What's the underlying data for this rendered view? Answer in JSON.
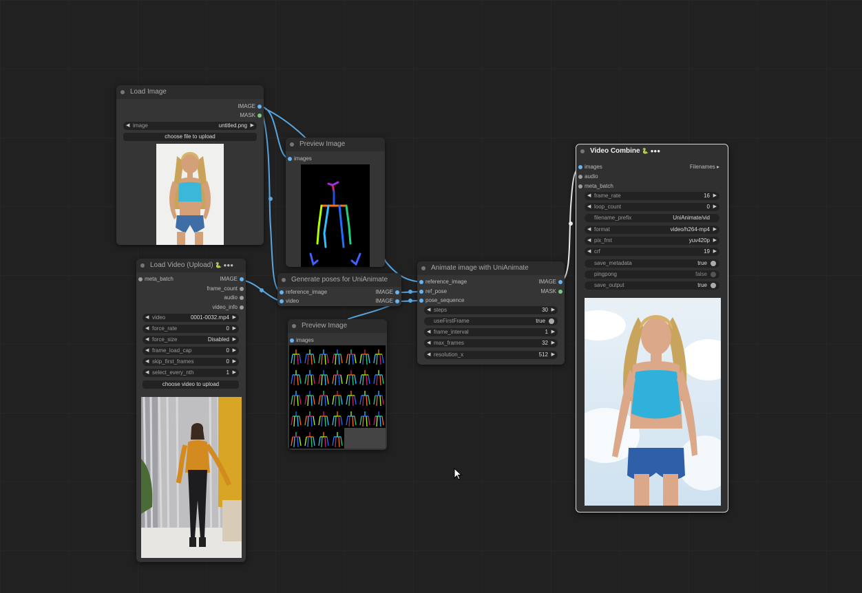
{
  "nodes": {
    "load_image": {
      "title": "Load Image",
      "outputs": [
        "IMAGE",
        "MASK"
      ],
      "widgets": {
        "image_label": "image",
        "image_value": "untitled.png"
      },
      "upload_button": "choose file to upload"
    },
    "preview_image_1": {
      "title": "Preview Image",
      "inputs": [
        "images"
      ]
    },
    "load_video": {
      "title": "Load Video (Upload)",
      "title_badges": "🐍 ●●●",
      "inputs": [
        "meta_batch"
      ],
      "outputs": [
        "IMAGE",
        "frame_count",
        "audio",
        "video_info"
      ],
      "widgets": [
        {
          "label": "video",
          "value": "0001-0032.mp4"
        },
        {
          "label": "force_rate",
          "value": "0"
        },
        {
          "label": "force_size",
          "value": "Disabled"
        },
        {
          "label": "frame_load_cap",
          "value": "0"
        },
        {
          "label": "skip_first_frames",
          "value": "0"
        },
        {
          "label": "select_every_nth",
          "value": "1"
        }
      ],
      "upload_button": "choose video to upload"
    },
    "generate_poses": {
      "title": "Generate poses for UniAnimate",
      "inputs": [
        "reference_image",
        "video"
      ],
      "outputs": [
        "IMAGE",
        "IMAGE"
      ]
    },
    "preview_image_2": {
      "title": "Preview Image",
      "inputs": [
        "images"
      ]
    },
    "animate": {
      "title": "Animate image with UniAnimate",
      "inputs": [
        "reference_image",
        "ref_pose",
        "pose_sequence"
      ],
      "outputs": [
        "IMAGE",
        "MASK"
      ],
      "widgets": [
        {
          "label": "steps",
          "value": "30",
          "kind": "number"
        },
        {
          "label": "useFirstFrame",
          "value": "true",
          "kind": "toggle"
        },
        {
          "label": "frame_interval",
          "value": "1",
          "kind": "number"
        },
        {
          "label": "max_frames",
          "value": "32",
          "kind": "number"
        },
        {
          "label": "resolution_x",
          "value": "512",
          "kind": "number"
        }
      ]
    },
    "video_combine": {
      "title": "Video Combine",
      "title_badges": "🐍 ●●●",
      "inputs": [
        "images",
        "audio",
        "meta_batch"
      ],
      "inputs_right_label": "Filenames ▸",
      "widgets": [
        {
          "label": "frame_rate",
          "value": "16",
          "kind": "number"
        },
        {
          "label": "loop_count",
          "value": "0",
          "kind": "number"
        },
        {
          "label": "filename_prefix",
          "value": "UniAnimate/vid",
          "kind": "text"
        },
        {
          "label": "format",
          "value": "video/h264-mp4",
          "kind": "combo"
        },
        {
          "label": "pix_fmt",
          "value": "yuv420p",
          "kind": "combo"
        },
        {
          "label": "crf",
          "value": "19",
          "kind": "number"
        },
        {
          "label": "save_metadata",
          "value": "true",
          "kind": "toggle"
        },
        {
          "label": "pingpong",
          "value": "false",
          "kind": "toggle"
        },
        {
          "label": "save_output",
          "value": "true",
          "kind": "toggle"
        }
      ]
    }
  },
  "colors": {
    "canvas": "#212121",
    "node": "#353535",
    "image_socket": "#64b5f6",
    "mask_socket": "#81c784",
    "wire": "#5aa7e0",
    "selected_border": "#d9d9d9"
  }
}
